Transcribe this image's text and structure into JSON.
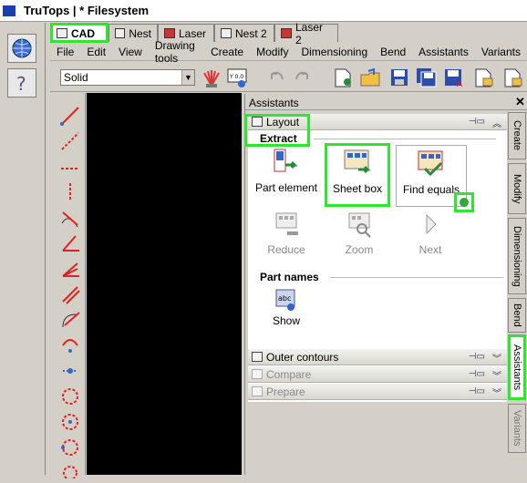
{
  "app": {
    "title": "TruTops  |  *  Filesystem"
  },
  "tabs": [
    {
      "label": "CAD"
    },
    {
      "label": "Nest"
    },
    {
      "label": "Laser"
    },
    {
      "label": "Nest 2"
    },
    {
      "label": "Laser 2"
    }
  ],
  "menu": [
    "File",
    "Edit",
    "View",
    "Drawing tools",
    "Create",
    "Modify",
    "Dimensioning",
    "Bend",
    "Assistants",
    "Variants"
  ],
  "toolbar": {
    "display_mode": "Solid"
  },
  "assistants": {
    "title": "Assistants",
    "close_label": "✕",
    "layout_section": "Layout",
    "extract_label": "Extract",
    "extract_buttons": [
      {
        "label": "Part element"
      },
      {
        "label": "Sheet box"
      },
      {
        "label": "Find equals"
      }
    ],
    "nav_buttons": [
      {
        "label": "Reduce"
      },
      {
        "label": "Zoom"
      },
      {
        "label": "Next"
      }
    ],
    "part_names_label": "Part names",
    "show_label": "Show",
    "sections": [
      {
        "label": "Outer contours"
      },
      {
        "label": "Compare"
      },
      {
        "label": "Prepare"
      }
    ]
  },
  "vertical_tabs": [
    "Create",
    "Modify",
    "Dimensioning",
    "Bend",
    "Assistants",
    "Variants"
  ],
  "colors": {
    "highlight": "#2ee62e",
    "canvas": "#000000"
  }
}
